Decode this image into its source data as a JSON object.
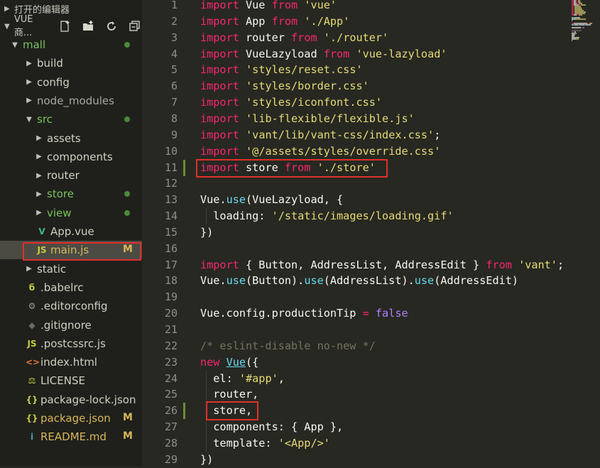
{
  "sidebar": {
    "open_editors_label": "打开的编辑器",
    "project_label": "VUE商...",
    "toolbar_icons": [
      "new-file-icon",
      "new-folder-icon",
      "refresh-icon",
      "collapse-all-icon"
    ],
    "tree": [
      {
        "label": "mall",
        "type": "folder-open",
        "depth": 0,
        "color": "#78c25a",
        "badge": "dot"
      },
      {
        "label": "build",
        "type": "folder",
        "depth": 1
      },
      {
        "label": "config",
        "type": "folder",
        "depth": 1
      },
      {
        "label": "node_modules",
        "type": "folder",
        "depth": 1,
        "color": "#a9a99f"
      },
      {
        "label": "src",
        "type": "folder-open",
        "depth": 1,
        "color": "#78c25a",
        "badge": "dot"
      },
      {
        "label": "assets",
        "type": "folder",
        "depth": 2
      },
      {
        "label": "components",
        "type": "folder",
        "depth": 2
      },
      {
        "label": "router",
        "type": "folder",
        "depth": 2
      },
      {
        "label": "store",
        "type": "folder",
        "depth": 2,
        "color": "#78c25a",
        "badge": "dot"
      },
      {
        "label": "view",
        "type": "folder",
        "depth": 2,
        "color": "#78c25a",
        "badge": "dot"
      },
      {
        "label": "App.vue",
        "type": "file",
        "depth": 2,
        "icon": "V",
        "icon_color": "#41b883"
      },
      {
        "label": "main.js",
        "type": "file",
        "depth": 2,
        "icon": "JS",
        "icon_color": "#cbcb41",
        "badge": "M",
        "selected": true,
        "color": "#d8b65a"
      },
      {
        "label": "static",
        "type": "folder",
        "depth": 1
      },
      {
        "label": ".babelrc",
        "type": "file",
        "depth": 1,
        "icon": "б",
        "icon_color": "#cbcb41"
      },
      {
        "label": ".editorconfig",
        "type": "file",
        "depth": 1,
        "icon": "⚙",
        "icon_color": "#9b9b92"
      },
      {
        "label": ".gitignore",
        "type": "file",
        "depth": 1,
        "icon": "◆",
        "icon_color": "#6d6d66"
      },
      {
        "label": ".postcssrc.js",
        "type": "file",
        "depth": 1,
        "icon": "JS",
        "icon_color": "#cbcb41"
      },
      {
        "label": "index.html",
        "type": "file",
        "depth": 1,
        "icon": "<>",
        "icon_color": "#e37933"
      },
      {
        "label": "LICENSE",
        "type": "file",
        "depth": 1,
        "icon": "⚖",
        "icon_color": "#cbcb41"
      },
      {
        "label": "package-lock.json",
        "type": "file",
        "depth": 1,
        "icon": "{}",
        "icon_color": "#cbcb41"
      },
      {
        "label": "package.json",
        "type": "file",
        "depth": 1,
        "icon": "{}",
        "icon_color": "#cbcb41",
        "badge": "M",
        "color": "#d8b65a"
      },
      {
        "label": "README.md",
        "type": "file",
        "depth": 1,
        "icon": "i",
        "icon_color": "#519aba",
        "badge": "M",
        "color": "#d8b65a"
      }
    ]
  },
  "editor": {
    "modified_lines": [
      11,
      26
    ],
    "lines": [
      [
        [
          "k",
          "import"
        ],
        [
          "t",
          " Vue "
        ],
        [
          "k",
          "from"
        ],
        [
          "t",
          " "
        ],
        [
          "s",
          "'vue'"
        ]
      ],
      [
        [
          "k",
          "import"
        ],
        [
          "t",
          " App "
        ],
        [
          "k",
          "from"
        ],
        [
          "t",
          " "
        ],
        [
          "s",
          "'./App'"
        ]
      ],
      [
        [
          "k",
          "import"
        ],
        [
          "t",
          " router "
        ],
        [
          "k",
          "from"
        ],
        [
          "t",
          " "
        ],
        [
          "s",
          "'./router'"
        ]
      ],
      [
        [
          "k",
          "import"
        ],
        [
          "t",
          " VueLazyload "
        ],
        [
          "k",
          "from"
        ],
        [
          "t",
          " "
        ],
        [
          "s",
          "'vue-lazyload'"
        ]
      ],
      [
        [
          "k",
          "import"
        ],
        [
          "t",
          " "
        ],
        [
          "s",
          "'styles/reset.css'"
        ]
      ],
      [
        [
          "k",
          "import"
        ],
        [
          "t",
          " "
        ],
        [
          "s",
          "'styles/border.css'"
        ]
      ],
      [
        [
          "k",
          "import"
        ],
        [
          "t",
          " "
        ],
        [
          "s",
          "'styles/iconfont.css'"
        ]
      ],
      [
        [
          "k",
          "import"
        ],
        [
          "t",
          " "
        ],
        [
          "s",
          "'lib-flexible/flexible.js'"
        ]
      ],
      [
        [
          "k",
          "import"
        ],
        [
          "t",
          " "
        ],
        [
          "s",
          "'vant/lib/vant-css/index.css'"
        ],
        [
          "t",
          ";"
        ]
      ],
      [
        [
          "k",
          "import"
        ],
        [
          "t",
          " "
        ],
        [
          "s",
          "'@/assets/styles/override.css'"
        ]
      ],
      [
        [
          "k",
          "import"
        ],
        [
          "t",
          " store "
        ],
        [
          "k",
          "from"
        ],
        [
          "t",
          " "
        ],
        [
          "s",
          "'./store'"
        ]
      ],
      [],
      [
        [
          "t",
          "Vue."
        ],
        [
          "f",
          "use"
        ],
        [
          "t",
          "(VueLazyload, {"
        ]
      ],
      [
        [
          "t",
          "  loading: "
        ],
        [
          "s",
          "'/static/images/loading.gif'"
        ]
      ],
      [
        [
          "t",
          "})"
        ]
      ],
      [],
      [
        [
          "k",
          "import"
        ],
        [
          "t",
          " { Button, AddressList, AddressEdit } "
        ],
        [
          "k",
          "from"
        ],
        [
          "t",
          " "
        ],
        [
          "s",
          "'vant'"
        ],
        [
          "t",
          ";"
        ]
      ],
      [
        [
          "t",
          "Vue."
        ],
        [
          "f",
          "use"
        ],
        [
          "t",
          "(Button)."
        ],
        [
          "f",
          "use"
        ],
        [
          "t",
          "(AddressList)."
        ],
        [
          "f",
          "use"
        ],
        [
          "t",
          "(AddressEdit)"
        ]
      ],
      [],
      [
        [
          "t",
          "Vue.config.productionTip "
        ],
        [
          "k",
          "="
        ],
        [
          "t",
          " "
        ],
        [
          "b",
          "false"
        ]
      ],
      [],
      [
        [
          "c",
          "/* eslint-disable no-new */"
        ]
      ],
      [
        [
          "k",
          "new"
        ],
        [
          "t",
          " "
        ],
        [
          "u",
          "Vue"
        ],
        [
          "t",
          "({"
        ]
      ],
      [
        [
          "t",
          "  el: "
        ],
        [
          "s",
          "'#app'"
        ],
        [
          "t",
          ","
        ]
      ],
      [
        [
          "t",
          "  router,"
        ]
      ],
      [
        [
          "t",
          "  store,"
        ]
      ],
      [
        [
          "t",
          "  components: { App },"
        ]
      ],
      [
        [
          "t",
          "  template: "
        ],
        [
          "s",
          "'<App/>'"
        ]
      ],
      [
        [
          "t",
          "})"
        ]
      ]
    ]
  },
  "colors": {
    "sidebar_bg": "#1f201b",
    "editor_bg": "#272822",
    "selection": "#4b4b44",
    "highlight_box": "#e0302a",
    "git_added": "#78c25a",
    "git_modified": "#d8b65a"
  }
}
